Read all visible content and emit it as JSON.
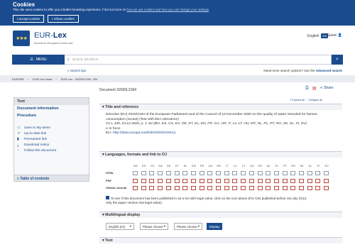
{
  "cookies": {
    "title": "Cookies",
    "text": "This site uses cookies to offer you a better browsing experience. Find out more on",
    "link": "how we use cookies and how you can change your settings",
    "end": ".",
    "accept": "I accept cookies",
    "refuse": "I refuse cookies"
  },
  "header": {
    "brand_prefix": "EUR-",
    "brand_suffix": "Lex",
    "subtitle": "Access to European Union law",
    "language": "English",
    "lang_code": "EN",
    "guest": "Guest"
  },
  "search": {
    "menu": "MENU",
    "placeholder": "QUICK SEARCH",
    "tips": "Search tips",
    "need_more": "Need more search options? Use the",
    "advanced": "Advanced search"
  },
  "breadcrumb": [
    "EUROPA",
    "EUR-Lex home",
    "EUR-Lex - 32020L2184 - EN"
  ],
  "document": {
    "title": "Document 32020L2184",
    "share": "Share"
  },
  "sidebar": {
    "title": "Text",
    "links": [
      "Document information",
      "Procedure"
    ],
    "actions": [
      "Save to My items",
      "Up-to-date link",
      "Permanent link",
      "Download notice",
      "Follow this document"
    ],
    "toc": "Table of contents"
  },
  "expand": {
    "expand_all": "Expand all",
    "collapse_all": "Collapse all"
  },
  "title_section": {
    "header": "Title and reference",
    "line1": "Directive (EU) 2020/2184 of the European Parliament and of the Council of 16 December 2020 on the quality of water intended for human",
    "line2": "consumption (recast) (Text with EEA relevance)",
    "oj": "OJ L 435, 23.12.2020, p. 1–62 (BG, ES, CS, DA, DE, ET, EL, EN, FR, GA, HR, IT, LV, LT, HU, MT, NL, PL, PT, RO, SK, SL, FI, SV)",
    "status": "In force",
    "eli_label": "ELI:",
    "eli": "http://data.europa.eu/eli/dir/2020/2184/oj"
  },
  "languages_section": {
    "header": "Languages, formats and link to OJ",
    "languages": [
      "BG",
      "ES",
      "CS",
      "DA",
      "DE",
      "ET",
      "EL",
      "EN",
      "FR",
      "GA",
      "HR",
      "IT",
      "LV",
      "LT",
      "HU",
      "MT",
      "NL",
      "PL",
      "PT",
      "RO",
      "SK",
      "SL",
      "FI",
      "SV"
    ],
    "rows": [
      "HTML",
      "PDF",
      "Official Journal"
    ],
    "note_line1": "To see if this document has been published in an e-OJ with legal value, click on the icon above (For OJs published before 1st July 2013,",
    "note_line2": "only the paper version has legal value)."
  },
  "multilingual": {
    "header": "Multilingual display",
    "select1": "English (en)",
    "select2": "Please choose",
    "select3": "Please choose",
    "display": "Display"
  },
  "text_section": {
    "header": "Text"
  }
}
